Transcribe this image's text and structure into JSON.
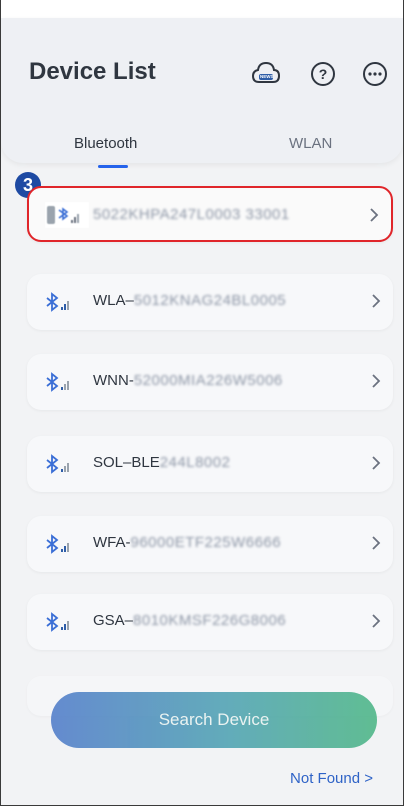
{
  "title": "Device List",
  "tabs": [
    {
      "label": "Bluetooth",
      "active": true
    },
    {
      "label": "WLAN",
      "active": false
    }
  ],
  "header_icons": [
    "cloud-news-icon",
    "help-icon",
    "more-icon"
  ],
  "cloud_icon_text": "NEWS",
  "step_marker": "3",
  "devices": [
    {
      "prefix": "",
      "blurred": "5022KHPA247L0003 33001",
      "selected": true
    },
    {
      "prefix": "WLA–",
      "blurred": "5012KNAG24BL0005",
      "selected": false
    },
    {
      "prefix": "WNN-",
      "blurred": "52000MIA226W5006",
      "selected": false
    },
    {
      "prefix": "SOL–BLE",
      "blurred": "244L8002",
      "selected": false
    },
    {
      "prefix": "WFA-",
      "blurred": "96000ETF225W6666",
      "selected": false
    },
    {
      "prefix": "GSA–",
      "blurred": "8010KMSF226G8006",
      "selected": false
    }
  ],
  "search_button": "Search Device",
  "not_found": "Not Found >",
  "colors": {
    "accent": "#2563eb",
    "selected_border": "#e0252a",
    "marker": "#1e4aa3"
  }
}
